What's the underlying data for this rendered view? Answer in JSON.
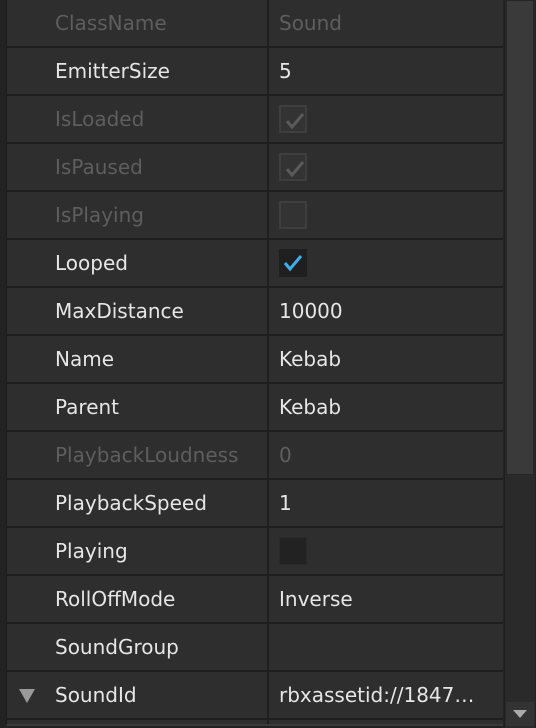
{
  "properties": [
    {
      "name": "ClassName",
      "value": "Sound",
      "disabled": true
    },
    {
      "name": "EmitterSize",
      "value": "5"
    },
    {
      "name": "IsLoaded",
      "checkbox": "checked",
      "disabled": true
    },
    {
      "name": "IsPaused",
      "checkbox": "checked",
      "disabled": true
    },
    {
      "name": "IsPlaying",
      "checkbox": "unchecked",
      "disabled": true
    },
    {
      "name": "Looped",
      "checkbox": "checked"
    },
    {
      "name": "MaxDistance",
      "value": "10000"
    },
    {
      "name": "Name",
      "value": "Kebab"
    },
    {
      "name": "Parent",
      "value": "Kebab"
    },
    {
      "name": "PlaybackLoudness",
      "value": "0",
      "disabled": true
    },
    {
      "name": "PlaybackSpeed",
      "value": "1"
    },
    {
      "name": "Playing",
      "checkbox": "unchecked"
    },
    {
      "name": "RollOffMode",
      "value": "Inverse"
    },
    {
      "name": "SoundGroup",
      "value": ""
    },
    {
      "name": "SoundId",
      "value": "rbxassetid://1847…",
      "expandable": true
    },
    {
      "name": "",
      "value": ""
    }
  ],
  "colors": {
    "check_accent": "#3daee9",
    "check_disabled": "#5a5a5a",
    "panel_bg": "#2e2e2e"
  },
  "scrollbar": {
    "position_fraction": 0
  }
}
